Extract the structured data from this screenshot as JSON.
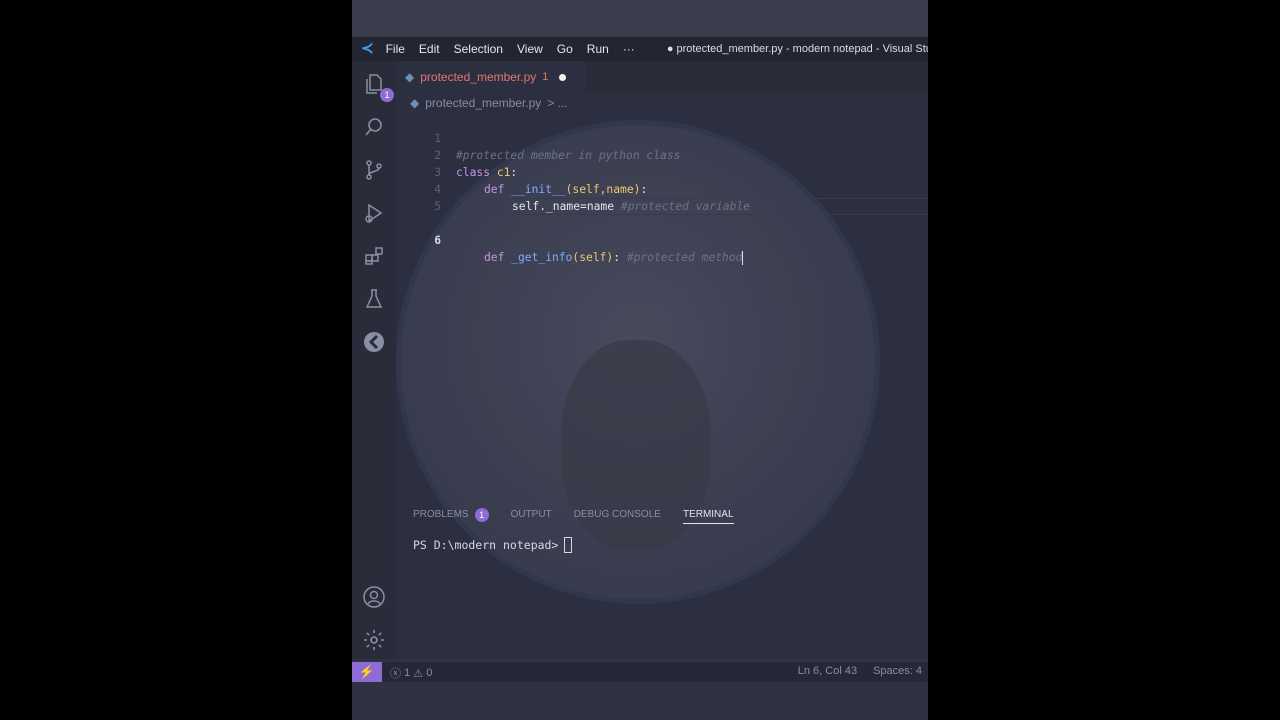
{
  "menu": [
    "File",
    "Edit",
    "Selection",
    "View",
    "Go",
    "Run",
    "···"
  ],
  "window_title": "● protected_member.py - modern notepad - Visual Studi",
  "activity_icons": [
    "explorer-icon",
    "search-icon",
    "source-control-icon",
    "run-debug-icon",
    "extensions-icon",
    "testing-icon",
    "remote-explorer-icon",
    "account-icon",
    "settings-gear-icon"
  ],
  "explorer_badge": "1",
  "tab": {
    "filename": "protected_member.py",
    "problem_count": "1"
  },
  "breadcrumb": {
    "file": "protected_member.py",
    "separator": "> ..."
  },
  "code": {
    "line_numbers": [
      "1",
      "2",
      "3",
      "4",
      "5",
      "6"
    ],
    "line1": "#protected member in python class",
    "line2_kw": "class",
    "line2_name": " c1",
    "line2_colon": ":",
    "line3_kw": "def",
    "line3_fn": " __init__",
    "line3_args": "(self,name)",
    "line3_colon": ":",
    "line4_code": "self._name=name ",
    "line4_comment": "#protected variable",
    "line6_kw": "def",
    "line6_fn": " _get_info",
    "line6_args": "(self)",
    "line6_colon": ": ",
    "line6_comment": "#protected method"
  },
  "panel": {
    "tabs": [
      "PROBLEMS",
      "OUTPUT",
      "DEBUG CONSOLE",
      "TERMINAL"
    ],
    "problems_badge": "1",
    "active_tab": "TERMINAL",
    "prompt": "PS D:\\modern notepad>"
  },
  "status": {
    "remote_icon": "⚡",
    "errors": "1",
    "warnings": "0",
    "position": "Ln 6, Col 43",
    "spaces": "Spaces: 4"
  },
  "colors": {
    "accent": "#8e6bd6",
    "keyword": "#c792ea",
    "function": "#82aaff",
    "comment": "#6d7287",
    "tab_modified": "#e2776f"
  }
}
